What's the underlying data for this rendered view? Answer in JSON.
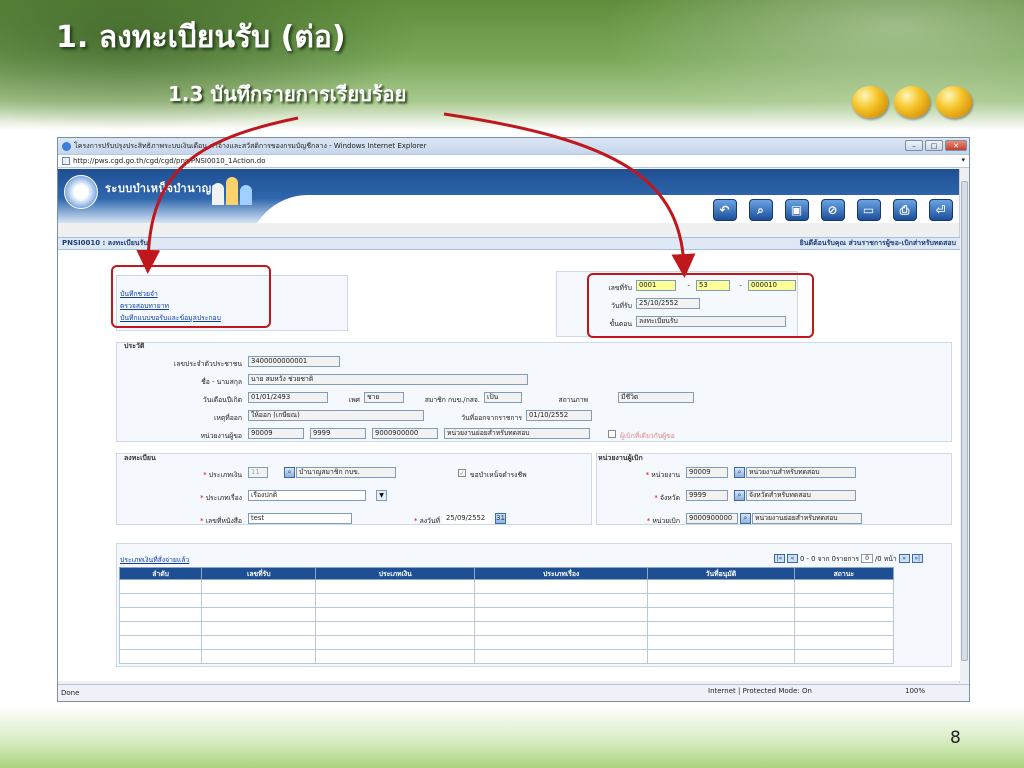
{
  "slide": {
    "title": "1. ลงทะเบียนรับ (ต่อ)",
    "subtitle": "1.3 บันทึกรายการเรียบร้อย",
    "page_number": "8"
  },
  "browser": {
    "window_title": "โครงการปรับปรุงประสิทธิภาพระบบเงินเดือน ค่าจ้างและสวัสดิการของกรมบัญชีกลาง - Windows Internet Explorer",
    "address": "http://pws.cgd.go.th/cgd/cgd/pns/PNSI0010_1Action.do",
    "status_left": "Done",
    "status_zone": "Internet | Protected Mode: On",
    "zoom": "100%"
  },
  "app": {
    "name": "ระบบบำเหน็จบำนาญฯ",
    "toolbar": [
      {
        "label": "กลับ",
        "icon": "back-icon",
        "glyph": "↶"
      },
      {
        "label": "หน้าค้นหา",
        "icon": "search-page-icon",
        "glyph": "⌕"
      },
      {
        "label": "บันทึก",
        "icon": "save-icon",
        "glyph": "▣"
      },
      {
        "label": "ยกเลิก",
        "icon": "cancel-icon",
        "glyph": "⊘"
      },
      {
        "label": "ลบข้อมูล",
        "icon": "delete-icon",
        "glyph": "▭"
      },
      {
        "label": "พิมพ์",
        "icon": "print-icon",
        "glyph": "⎙"
      },
      {
        "label": "ออก",
        "icon": "exit-icon",
        "glyph": "⏎"
      }
    ],
    "screen_code": "PNSI0010 : ลงทะเบียนรับ",
    "welcome": "ยินดีต้อนรับคุณ ส่วนราชการผู้ขอ-เบิกส่าหรับทดสอบ"
  },
  "links": [
    "บันทึกช่วยจำ",
    "ตรวจสอบทายาท",
    "บันทึกแบบขอรับและข้อมูลประกอบ"
  ],
  "receipt": {
    "no_label": "เลขที่รับ",
    "no_part1": "0001",
    "no_part2": "53",
    "no_part3": "000010",
    "dash": "-",
    "date_label": "วันที่รับ",
    "date": "25/10/2552",
    "step_label": "ขั้นตอน",
    "step": "ลงทะเบียนรับ"
  },
  "history": {
    "section": "ประวัติ",
    "citizen_id_label": "เลขประจำตัวประชาชน",
    "citizen_id": "3400000000001",
    "name_label": "ชื่อ - นามสกุล",
    "name": "นาย สมหวัง ช่วยชาติ",
    "birth_label": "วันเดือนปีเกิด",
    "birth": "01/01/2493",
    "sex_label": "เพศ",
    "sex": "ชาย",
    "member_label": "สมาชิก กบข./กสจ.",
    "member": "เป็น",
    "status_label": "สถานภาพ",
    "status": "มีชีวิต",
    "reason_label": "เหตุที่ออก",
    "reason": "ให้ออก (เกษียณ)",
    "retire_date_label": "วันที่ออกจากราชการ",
    "retire_date": "01/10/2552",
    "unit_label": "หน่วยงานผู้ขอ",
    "unit_code1": "90009",
    "unit_code2": "9999",
    "unit_code3": "9000900000",
    "unit_name": "หน่วยงานย่อยสำหรับทดสอบ",
    "same_payer": "ผู้เบิกที่เดียวกับผู้ขอ"
  },
  "register": {
    "section": "ลงทะเบียน",
    "money_type_label": "ประเภทเงิน",
    "money_type_code": "11",
    "money_type": "บำนาญสมาชิก กบข.",
    "vital_label": "ขอบำเหน็จดำรงชีพ",
    "case_type_label": "ประเภทเรื่อง",
    "case_type": "เรื่องปกติ",
    "doc_no_label": "เลขที่หนังสือ",
    "doc_no": "test",
    "sign_date_label": "ลงวันที่",
    "sign_date": "25/09/2552",
    "cal_glyph": "31",
    "required_mark": "*"
  },
  "payer": {
    "section": "หน่วยงานผู้เบิก",
    "agency_label": "หน่วยงาน",
    "agency_code": "90009",
    "agency_name": "หน่วยงานสำหรับทดสอบ",
    "province_label": "จังหวัด",
    "province_code": "9999",
    "province_name": "จังหวัดสำหรับทดสอบ",
    "payer_unit_label": "หน่วยเบิก",
    "payer_unit_code": "9000900000",
    "payer_unit_name": "หน่วยงานย่อยสำหรับทดสอบ"
  },
  "grid": {
    "caption": "ประเภทเงินที่สั่งจ่ายแล้ว",
    "pager_text": "0 - 0 จาก 0รายการ",
    "page_input": "0",
    "page_suffix": "/0 หน้า",
    "columns": [
      "ลำดับ",
      "เลขที่รับ",
      "ประเภทเงิน",
      "ประเภทเรื่อง",
      "วันที่อนุมัติ",
      "สถานะ"
    ],
    "rows": [
      [
        "",
        "",
        "",
        "",
        "",
        ""
      ],
      [
        "",
        "",
        "",
        "",
        "",
        ""
      ],
      [
        "",
        "",
        "",
        "",
        "",
        ""
      ],
      [
        "",
        "",
        "",
        "",
        "",
        ""
      ],
      [
        "",
        "",
        "",
        "",
        "",
        ""
      ],
      [
        "",
        "",
        "",
        "",
        "",
        ""
      ]
    ]
  },
  "colors": {
    "accent_red": "#c0171c",
    "header_blue": "#1f4f93",
    "highlight_yellow": "#ffff99"
  }
}
